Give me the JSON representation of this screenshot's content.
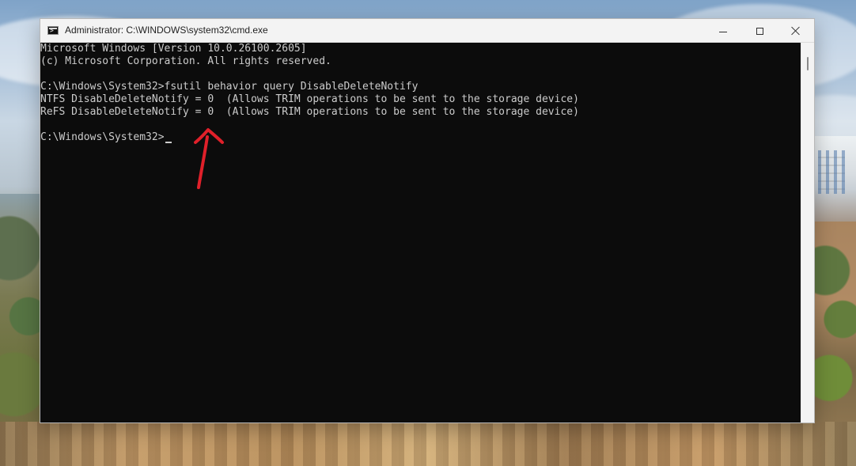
{
  "window": {
    "title": "Administrator: C:\\WINDOWS\\system32\\cmd.exe",
    "icon": "cmd-icon",
    "controls": {
      "minimize_icon": "minimize-icon",
      "maximize_icon": "maximize-icon",
      "close_icon": "close-icon"
    }
  },
  "console": {
    "lines": [
      "Microsoft Windows [Version 10.0.26100.2605]",
      "(c) Microsoft Corporation. All rights reserved.",
      "",
      "C:\\Windows\\System32>fsutil behavior query DisableDeleteNotify",
      "NTFS DisableDeleteNotify = 0  (Allows TRIM operations to be sent to the storage device)",
      "ReFS DisableDeleteNotify = 0  (Allows TRIM operations to be sent to the storage device)",
      "",
      "C:\\Windows\\System32>"
    ]
  },
  "annotation": {
    "icon": "red-arrow-icon",
    "color": "#e0202a"
  },
  "colors": {
    "titlebar_bg": "#f3f3f3",
    "console_bg": "#0c0c0c",
    "console_text": "#cccccc",
    "annotation_red": "#e0202a"
  }
}
